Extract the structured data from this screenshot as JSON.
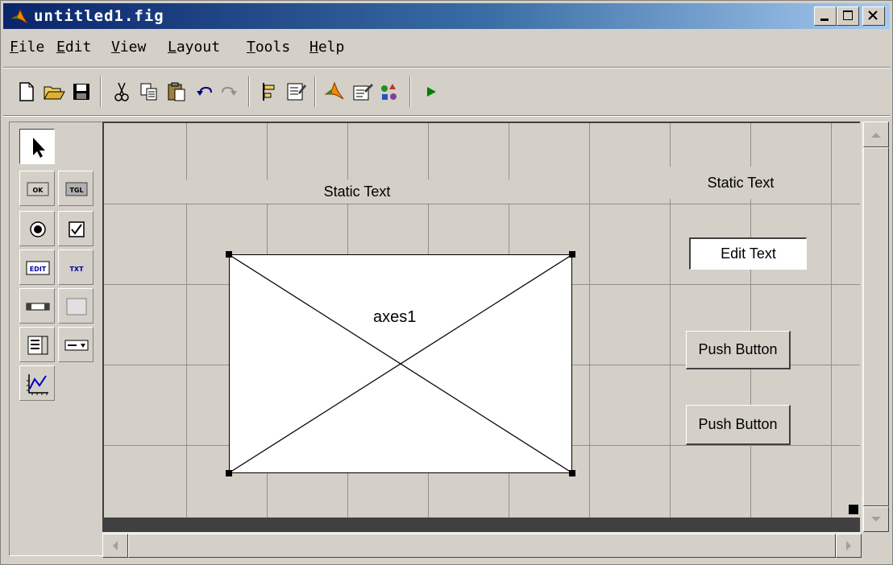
{
  "window": {
    "title": "untitled1.fig"
  },
  "menu": [
    "File",
    "Edit",
    "View",
    "Layout",
    "Tools",
    "Help"
  ],
  "toolbar": [
    "new",
    "open",
    "save",
    "cut",
    "copy",
    "paste",
    "undo",
    "redo",
    "align",
    "menu-editor",
    "editor",
    "property-inspector",
    "object-browser",
    "run"
  ],
  "palette": [
    "select",
    "push-button",
    "toggle-button",
    "radio-button",
    "checkbox",
    "edit-text",
    "static-text",
    "slider",
    "frame",
    "listbox",
    "popup-menu",
    "axes"
  ],
  "canvas": {
    "static_text_1": "Static Text",
    "static_text_2": "Static Text",
    "edit_text": "Edit Text",
    "axes": "axes1",
    "push_button_1": "Push Button",
    "push_button_2": "Push Button"
  },
  "colors": {
    "title_start": "#0a246a",
    "title_end": "#a6caf0",
    "face": "#d4d0c8",
    "run_green": "#008000"
  }
}
